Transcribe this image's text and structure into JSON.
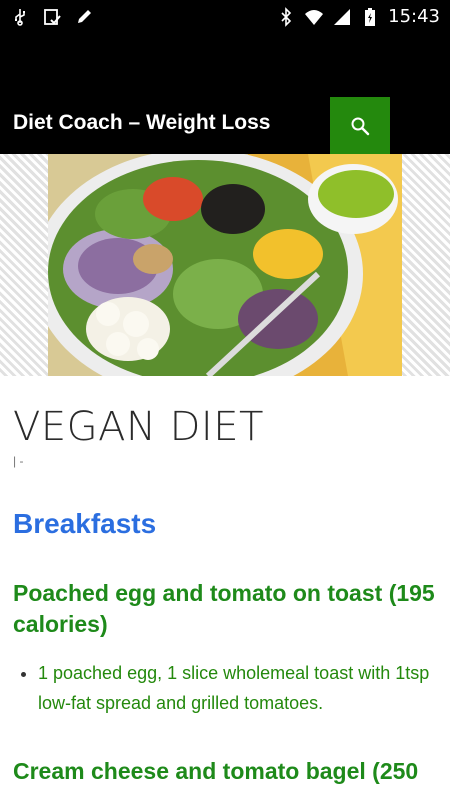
{
  "status_bar": {
    "time": "15:43",
    "left_icons": [
      "usb-icon",
      "clipboard-check-icon",
      "pencil-icon"
    ],
    "right_icons": [
      "bluetooth-icon",
      "wifi-icon",
      "signal-icon",
      "battery-icon"
    ]
  },
  "app_bar": {
    "title": "Diet Coach – Weight Loss",
    "search_icon": "search-icon",
    "accent": "#24890d"
  },
  "post": {
    "title": "VEGAN DIET",
    "meta": "| -",
    "section": "Breakfasts",
    "meals": [
      {
        "title": "Poached egg and tomato on toast (195 calories)",
        "items": [
          "1 poached egg, 1 slice wholemeal toast with 1tsp low-fat spread and grilled tomatoes."
        ]
      },
      {
        "title": "Cream cheese and tomato bagel (250"
      }
    ]
  }
}
